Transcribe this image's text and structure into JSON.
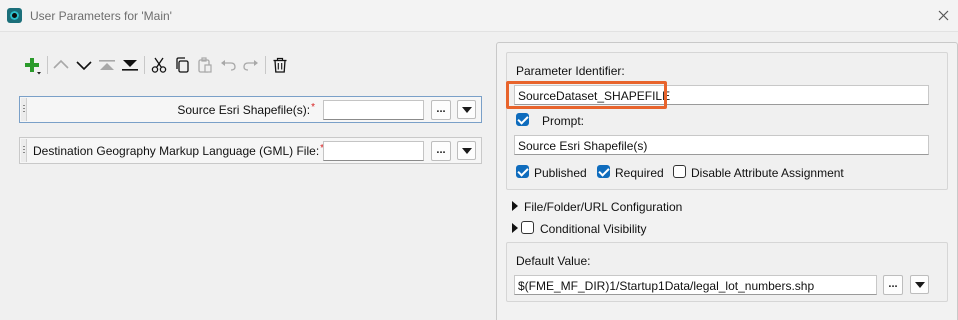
{
  "window": {
    "title": "User Parameters for 'Main'"
  },
  "toolbar": {
    "icons": [
      "add-icon",
      "move-up-icon",
      "move-down-icon",
      "move-top-icon",
      "move-bottom-icon",
      "cut-icon",
      "copy-icon",
      "paste-icon",
      "undo-icon",
      "redo-icon",
      "delete-icon"
    ],
    "add_color": "#2a9a2a"
  },
  "parameters": [
    {
      "label": "Source Esri Shapefile(s):",
      "required_mark": "*",
      "value": "",
      "browse_label": "..."
    },
    {
      "label": "Destination Geography Markup Language (GML) File:",
      "required_mark": "*",
      "value": "",
      "browse_label": "..."
    }
  ],
  "details": {
    "identifier_label": "Parameter Identifier:",
    "identifier_value": "SourceDataset_SHAPEFILE",
    "prompt_label": "Prompt:",
    "prompt_checked": true,
    "prompt_value": "Source Esri Shapefile(s)",
    "published_label": "Published",
    "published_checked": true,
    "required_label": "Required",
    "required_checked": true,
    "disable_attr_label": "Disable Attribute Assignment",
    "disable_attr_checked": false,
    "file_config_label": "File/Folder/URL Configuration",
    "conditional_label": "Conditional Visibility",
    "conditional_checked": false,
    "default_value_label": "Default Value:",
    "default_value": "$(FME_MF_DIR)1/Startup1Data/legal_lot_numbers.shp",
    "browse_label": "..."
  },
  "colors": {
    "highlight": "#e8642c",
    "checkbox": "#0f6cbd",
    "required_mark": "#d72020"
  }
}
